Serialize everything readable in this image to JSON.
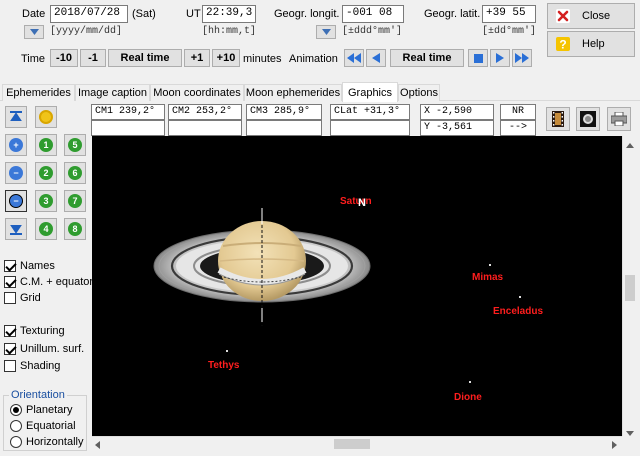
{
  "date": {
    "label": "Date",
    "value": "2018/07/28",
    "weekday": "(Sat)",
    "hint": "[yyyy/mm/dd]"
  },
  "ut": {
    "label": "UT",
    "value": "22:39,3",
    "hint": "[hh:mm,t]"
  },
  "longitude": {
    "label": "Geogr. longit.",
    "value": "-001 08",
    "hint": "[±ddd°mm']"
  },
  "latitude": {
    "label": "Geogr. latit.",
    "value": "+39 55",
    "hint": "[±dd°mm']"
  },
  "buttons": {
    "close": "Close",
    "help": "Help"
  },
  "time_controls": {
    "label": "Time",
    "minus10": "-10",
    "minus1": "-1",
    "realtime": "Real time",
    "plus1": "+1",
    "plus10": "+10",
    "units": "minutes"
  },
  "animation": {
    "label": "Animation",
    "realtime": "Real time"
  },
  "tabs": [
    {
      "label": "Ephemerides"
    },
    {
      "label": "Image caption"
    },
    {
      "label": "Moon coordinates"
    },
    {
      "label": "Moon ephemerides"
    },
    {
      "label": "Graphics"
    },
    {
      "label": "Options"
    }
  ],
  "readouts": {
    "cm1": "CM1 239,2°",
    "cm2": "CM2 253,2°",
    "cm3": "CM3 285,9°",
    "clat": "CLat +31,3°",
    "x": "X   -2,590",
    "y": "Y   -3,561",
    "nr": "NR",
    "arrow": "-->"
  },
  "zoom_buttons": [
    "1",
    "2",
    "3",
    "4",
    "5",
    "6",
    "7",
    "8"
  ],
  "checks": {
    "names": "Names",
    "cm_equator": "C.M. + equator",
    "grid": "Grid",
    "texturing": "Texturing",
    "unillum": "Unillum. surf.",
    "shading": "Shading"
  },
  "orientation": {
    "title": "Orientation",
    "planetary": "Planetary",
    "equatorial": "Equatorial",
    "horizontally": "Horizontally"
  },
  "canvas": {
    "planet": "Saturn",
    "pole_marker": "N",
    "moons": [
      "Mimas",
      "Enceladus",
      "Tethys",
      "Dione"
    ]
  },
  "colors": {
    "moon_label": "#ff1e1e",
    "planet": "#e8d2a0",
    "sky": "#000000"
  }
}
